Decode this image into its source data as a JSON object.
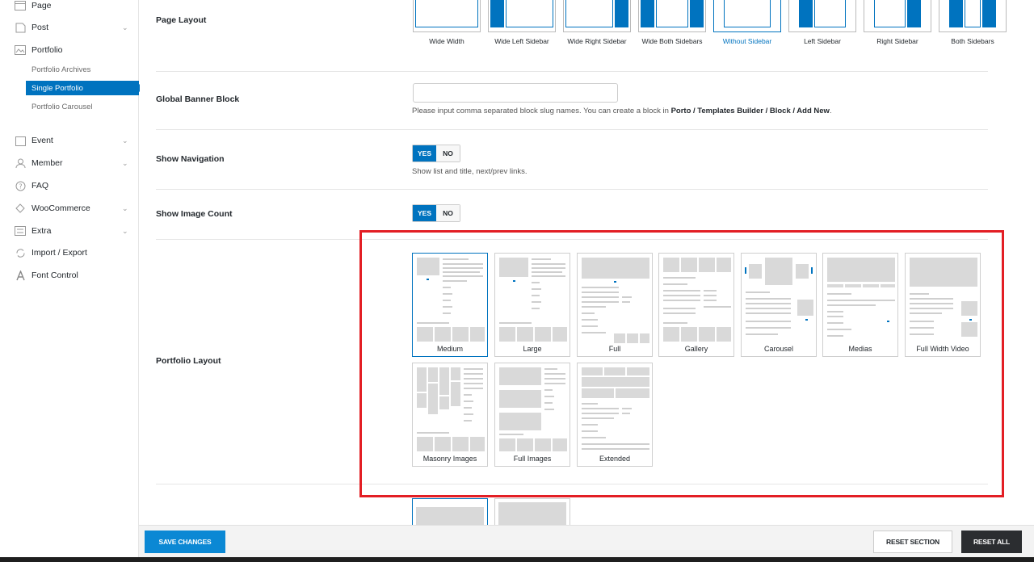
{
  "sidebar": {
    "items": [
      {
        "label": "Page",
        "icon": "page-icon",
        "chevron": false
      },
      {
        "label": "Post",
        "icon": "post-icon",
        "chevron": true
      },
      {
        "label": "Portfolio",
        "icon": "portfolio-icon",
        "chevron": false
      },
      {
        "label": "Event",
        "icon": "event-icon",
        "chevron": true
      },
      {
        "label": "Member",
        "icon": "member-icon",
        "chevron": true
      },
      {
        "label": "FAQ",
        "icon": "faq-icon",
        "chevron": false
      },
      {
        "label": "WooCommerce",
        "icon": "woocommerce-icon",
        "chevron": true
      },
      {
        "label": "Extra",
        "icon": "extra-icon",
        "chevron": true
      },
      {
        "label": "Import / Export",
        "icon": "import-export-icon",
        "chevron": false
      },
      {
        "label": "Font Control",
        "icon": "font-control-icon",
        "chevron": false
      }
    ],
    "portfolio_sub": [
      {
        "label": "Portfolio Archives",
        "active": false
      },
      {
        "label": "Single Portfolio",
        "active": true
      },
      {
        "label": "Portfolio Carousel",
        "active": false
      }
    ]
  },
  "main": {
    "page_layout": {
      "label": "Page Layout",
      "options": [
        {
          "label": "Wide Width",
          "selected": false
        },
        {
          "label": "Wide Left Sidebar",
          "selected": false
        },
        {
          "label": "Wide Right Sidebar",
          "selected": false
        },
        {
          "label": "Wide Both Sidebars",
          "selected": false
        },
        {
          "label": "Without Sidebar",
          "selected": true
        },
        {
          "label": "Left Sidebar",
          "selected": false
        },
        {
          "label": "Right Sidebar",
          "selected": false
        },
        {
          "label": "Both Sidebars",
          "selected": false
        }
      ]
    },
    "global_banner": {
      "label": "Global Banner Block",
      "value": "",
      "help_prefix": "Please input comma separated block slug names. You can create a block in ",
      "help_path": "Porto / Templates Builder / Block / Add New",
      "help_suffix": "."
    },
    "show_navigation": {
      "label": "Show Navigation",
      "yes": "YES",
      "no": "NO",
      "value": "YES",
      "help": "Show list and title, next/prev links."
    },
    "show_image_count": {
      "label": "Show Image Count",
      "yes": "YES",
      "no": "NO",
      "value": "YES"
    },
    "portfolio_layout": {
      "label": "Portfolio Layout",
      "options": [
        {
          "label": "Medium",
          "selected": true
        },
        {
          "label": "Large",
          "selected": false
        },
        {
          "label": "Full",
          "selected": false
        },
        {
          "label": "Gallery",
          "selected": false
        },
        {
          "label": "Carousel",
          "selected": false
        },
        {
          "label": "Medias",
          "selected": false
        },
        {
          "label": "Full Width Video",
          "selected": false
        },
        {
          "label": "Masonry Images",
          "selected": false
        },
        {
          "label": "Full Images",
          "selected": false
        },
        {
          "label": "Extended",
          "selected": false
        }
      ]
    }
  },
  "footer": {
    "save": "SAVE CHANGES",
    "reset_section": "RESET SECTION",
    "reset_all": "RESET ALL"
  },
  "colors": {
    "accent": "#0073bf",
    "highlight": "#e31e24"
  }
}
